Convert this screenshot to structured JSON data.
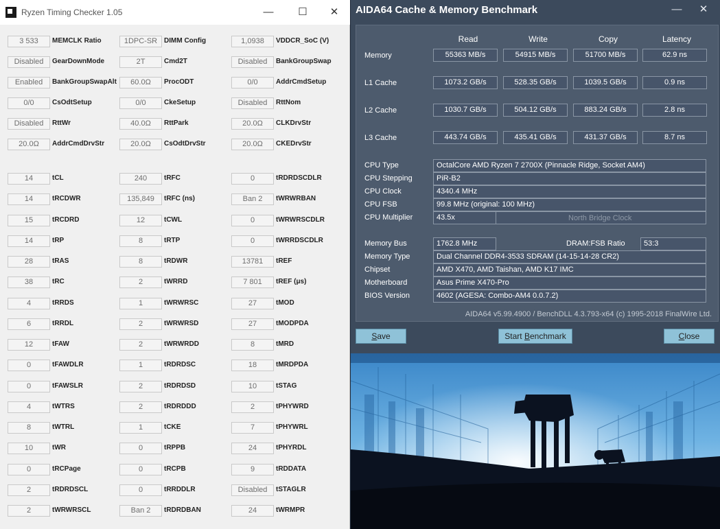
{
  "rtc": {
    "title": "Ryzen Timing Checker 1.05",
    "window_buttons": {
      "minimize": "—",
      "maximize": "☐",
      "close": "✕"
    },
    "top_rows": [
      [
        {
          "value": "3 533",
          "label": "MEMCLK Ratio"
        },
        {
          "value": "1DPC-SR",
          "label": "DIMM Config"
        },
        {
          "value": "1,0938",
          "label": "VDDCR_SoC (V)"
        }
      ],
      [
        {
          "value": "Disabled",
          "label": "GearDownMode"
        },
        {
          "value": "2T",
          "label": "Cmd2T"
        },
        {
          "value": "Disabled",
          "label": "BankGroupSwap"
        }
      ],
      [
        {
          "value": "Enabled",
          "label": "BankGroupSwapAlt"
        },
        {
          "value": "60.0Ω",
          "label": "ProcODT"
        },
        {
          "value": "0/0",
          "label": "AddrCmdSetup"
        }
      ],
      [
        {
          "value": "0/0",
          "label": "CsOdtSetup"
        },
        {
          "value": "0/0",
          "label": "CkeSetup"
        },
        {
          "value": "Disabled",
          "label": "RttNom"
        }
      ],
      [
        {
          "value": "Disabled",
          "label": "RttWr"
        },
        {
          "value": "40.0Ω",
          "label": "RttPark"
        },
        {
          "value": "20.0Ω",
          "label": "CLKDrvStr"
        }
      ],
      [
        {
          "value": "20.0Ω",
          "label": "AddrCmdDrvStr"
        },
        {
          "value": "20.0Ω",
          "label": "CsOdtDrvStr"
        },
        {
          "value": "20.0Ω",
          "label": "CKEDrvStr"
        }
      ]
    ],
    "timing_rows": [
      [
        {
          "value": "14",
          "label": "tCL"
        },
        {
          "value": "240",
          "label": "tRFC"
        },
        {
          "value": "0",
          "label": "tRDRDSCDLR"
        }
      ],
      [
        {
          "value": "14",
          "label": "tRCDWR"
        },
        {
          "value": "135,849",
          "label": "tRFC (ns)"
        },
        {
          "value": "Ban 2",
          "label": "tWRWRBAN"
        }
      ],
      [
        {
          "value": "15",
          "label": "tRCDRD"
        },
        {
          "value": "12",
          "label": "tCWL"
        },
        {
          "value": "0",
          "label": "tWRWRSCDLR"
        }
      ],
      [
        {
          "value": "14",
          "label": "tRP"
        },
        {
          "value": "8",
          "label": "tRTP"
        },
        {
          "value": "0",
          "label": "tWRRDSCDLR"
        }
      ],
      [
        {
          "value": "28",
          "label": "tRAS"
        },
        {
          "value": "8",
          "label": "tRDWR"
        },
        {
          "value": "13781",
          "label": "tREF"
        }
      ],
      [
        {
          "value": "38",
          "label": "tRC"
        },
        {
          "value": "2",
          "label": "tWRRD"
        },
        {
          "value": "7 801",
          "label": "tREF (μs)"
        }
      ],
      [
        {
          "value": "4",
          "label": "tRRDS"
        },
        {
          "value": "1",
          "label": "tWRWRSC"
        },
        {
          "value": "27",
          "label": "tMOD"
        }
      ],
      [
        {
          "value": "6",
          "label": "tRRDL"
        },
        {
          "value": "2",
          "label": "tWRWRSD"
        },
        {
          "value": "27",
          "label": "tMODPDA"
        }
      ],
      [
        {
          "value": "12",
          "label": "tFAW"
        },
        {
          "value": "2",
          "label": "tWRWRDD"
        },
        {
          "value": "8",
          "label": "tMRD"
        }
      ],
      [
        {
          "value": "0",
          "label": "tFAWDLR"
        },
        {
          "value": "1",
          "label": "tRDRDSC"
        },
        {
          "value": "18",
          "label": "tMRDPDA"
        }
      ],
      [
        {
          "value": "0",
          "label": "tFAWSLR"
        },
        {
          "value": "2",
          "label": "tRDRDSD"
        },
        {
          "value": "10",
          "label": "tSTAG"
        }
      ],
      [
        {
          "value": "4",
          "label": "tWTRS"
        },
        {
          "value": "2",
          "label": "tRDRDDD"
        },
        {
          "value": "2",
          "label": "tPHYWRD"
        }
      ],
      [
        {
          "value": "8",
          "label": "tWTRL"
        },
        {
          "value": "1",
          "label": "tCKE"
        },
        {
          "value": "7",
          "label": "tPHYWRL"
        }
      ],
      [
        {
          "value": "10",
          "label": "tWR"
        },
        {
          "value": "0",
          "label": "tRPPB"
        },
        {
          "value": "24",
          "label": "tPHYRDL"
        }
      ],
      [
        {
          "value": "0",
          "label": "tRCPage"
        },
        {
          "value": "0",
          "label": "tRCPB"
        },
        {
          "value": "9",
          "label": "tRDDATA"
        }
      ],
      [
        {
          "value": "2",
          "label": "tRDRDSCL"
        },
        {
          "value": "0",
          "label": "tRRDDLR"
        },
        {
          "value": "Disabled",
          "label": "tSTAGLR"
        }
      ],
      [
        {
          "value": "2",
          "label": "tWRWRSCL"
        },
        {
          "value": "Ban 2",
          "label": "tRDRDBAN"
        },
        {
          "value": "24",
          "label": "tWRMPR"
        }
      ]
    ]
  },
  "aida": {
    "title": "AIDA64 Cache & Memory Benchmark",
    "window_buttons": {
      "minimize": "—",
      "close": "✕"
    },
    "headers": [
      "Read",
      "Write",
      "Copy",
      "Latency"
    ],
    "bench_rows": [
      {
        "label": "Memory",
        "values": [
          "55363 MB/s",
          "54915 MB/s",
          "51700 MB/s",
          "62.9 ns"
        ]
      },
      {
        "label": "L1 Cache",
        "values": [
          "1073.2 GB/s",
          "528.35 GB/s",
          "1039.5 GB/s",
          "0.9 ns"
        ]
      },
      {
        "label": "L2 Cache",
        "values": [
          "1030.7 GB/s",
          "504.12 GB/s",
          "883.24 GB/s",
          "2.8 ns"
        ]
      },
      {
        "label": "L3 Cache",
        "values": [
          "443.74 GB/s",
          "435.41 GB/s",
          "431.37 GB/s",
          "8.7 ns"
        ]
      }
    ],
    "cpu": {
      "type_label": "CPU Type",
      "type": "OctalCore AMD Ryzen 7 2700X  (Pinnacle Ridge, Socket AM4)",
      "stepping_label": "CPU Stepping",
      "stepping": "PiR-B2",
      "clock_label": "CPU Clock",
      "clock": "4340.4 MHz",
      "fsb_label": "CPU FSB",
      "fsb": "99.8 MHz  (original: 100 MHz)",
      "multiplier_label": "CPU Multiplier",
      "multiplier": "43.5x",
      "nb_clock_label": "North Bridge Clock"
    },
    "memory": {
      "bus_label": "Memory Bus",
      "bus": "1762.8 MHz",
      "ratio_label": "DRAM:FSB Ratio",
      "ratio": "53:3",
      "type_label": "Memory Type",
      "type": "Dual Channel DDR4-3533 SDRAM  (14-15-14-28 CR2)",
      "chipset_label": "Chipset",
      "chipset": "AMD X470, AMD Taishan, AMD K17 IMC",
      "motherboard_label": "Motherboard",
      "motherboard": "Asus Prime X470-Pro",
      "bios_label": "BIOS Version",
      "bios": "4602  (AGESA: Combo-AM4 0.0.7.2)"
    },
    "footer": "AIDA64 v5.99.4900 / BenchDLL 4.3.793-x64  (c) 1995-2018 FinalWire Ltd.",
    "buttons": {
      "save_first": "S",
      "save_rest": "ave",
      "start_first": "Start ",
      "start_u": "B",
      "start_rest": "enchmark",
      "close_first": "C",
      "close_rest": "lose"
    }
  },
  "colors": {
    "aida_bg": "#3c4a5c",
    "button": "#8fc2d8",
    "rtc_bg": "#f0f0f0"
  }
}
